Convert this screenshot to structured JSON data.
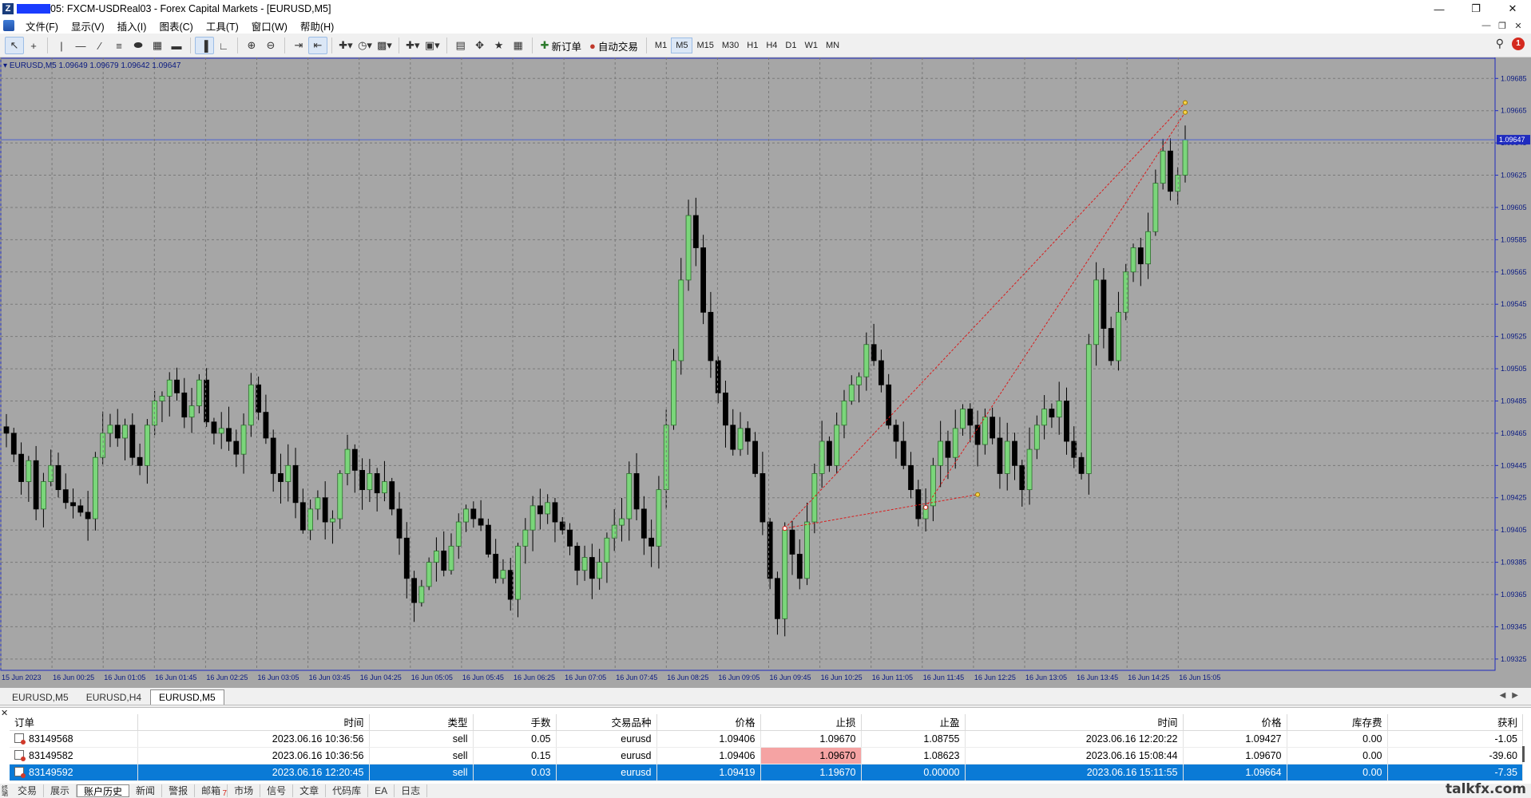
{
  "window": {
    "title": "05: FXCM-USDReal03 - Forex Capital Markets - [EURUSD,M5]",
    "controls": [
      "minimize-icon",
      "restore-icon",
      "close-icon"
    ]
  },
  "menu": {
    "items": [
      "文件(F)",
      "显示(V)",
      "插入(I)",
      "图表(C)",
      "工具(T)",
      "窗口(W)",
      "帮助(H)"
    ]
  },
  "toolbar": {
    "new_order_label": "新订单",
    "auto_trading_label": "自动交易",
    "timeframes": [
      "M1",
      "M5",
      "M15",
      "M30",
      "H1",
      "H4",
      "D1",
      "W1",
      "MN"
    ],
    "active_timeframe": "M5",
    "notification_count": "1"
  },
  "chart": {
    "info_line": "EURUSD,M5  1.09649 1.09679 1.09642 1.09647",
    "current_price": "1.09647",
    "background_color": "#a6a6a6",
    "grid_color": "#7a7a7a",
    "bull_color": "#7ad67a",
    "bear_color": "#000000",
    "price_line_color": "#4d5fcf",
    "trade_line_color": "#d91c1c"
  },
  "chart_data": {
    "type": "candlestick",
    "symbol": "EURUSD",
    "timeframe": "M5",
    "y_ticks": [
      "1.09685",
      "1.09665",
      "1.09645",
      "1.09625",
      "1.09605",
      "1.09585",
      "1.09565",
      "1.09545",
      "1.09525",
      "1.09505",
      "1.09485",
      "1.09465",
      "1.09445",
      "1.09425",
      "1.09405",
      "1.09385",
      "1.09365",
      "1.09345",
      "1.09325"
    ],
    "ylim": [
      1.09318,
      1.09698
    ],
    "x_ticks": [
      "15 Jun 2023",
      "16 Jun 00:25",
      "16 Jun 01:05",
      "16 Jun 01:45",
      "16 Jun 02:25",
      "16 Jun 03:05",
      "16 Jun 03:45",
      "16 Jun 04:25",
      "16 Jun 05:05",
      "16 Jun 05:45",
      "16 Jun 06:25",
      "16 Jun 07:05",
      "16 Jun 07:45",
      "16 Jun 08:25",
      "16 Jun 09:05",
      "16 Jun 09:45",
      "16 Jun 10:25",
      "16 Jun 11:05",
      "16 Jun 11:45",
      "16 Jun 12:25",
      "16 Jun 13:05",
      "16 Jun 13:45",
      "16 Jun 14:25",
      "16 Jun 15:05"
    ],
    "close_path": [
      1.09465,
      1.09452,
      1.09435,
      1.09448,
      1.09418,
      1.09435,
      1.09445,
      1.0943,
      1.09422,
      1.0942,
      1.09416,
      1.09412,
      1.0945,
      1.09465,
      1.0947,
      1.09462,
      1.0947,
      1.0945,
      1.09445,
      1.0947,
      1.09485,
      1.09488,
      1.09498,
      1.0949,
      1.09475,
      1.09482,
      1.09498,
      1.09472,
      1.09465,
      1.09468,
      1.0946,
      1.09452,
      1.0947,
      1.09495,
      1.09478,
      1.09462,
      1.0944,
      1.09435,
      1.09445,
      1.09422,
      1.09405,
      1.09418,
      1.09425,
      1.0941,
      1.09412,
      1.0944,
      1.09455,
      1.09442,
      1.0943,
      1.0944,
      1.09428,
      1.09435,
      1.09418,
      1.094,
      1.09375,
      1.0936,
      1.0937,
      1.09385,
      1.09392,
      1.0938,
      1.09395,
      1.0941,
      1.09418,
      1.09412,
      1.09408,
      1.0939,
      1.09375,
      1.0938,
      1.09362,
      1.09395,
      1.09405,
      1.0942,
      1.09415,
      1.09422,
      1.0941,
      1.09405,
      1.09395,
      1.0938,
      1.09388,
      1.09375,
      1.09385,
      1.094,
      1.09408,
      1.09412,
      1.0944,
      1.09418,
      1.094,
      1.09395,
      1.0943,
      1.0947,
      1.0951,
      1.0956,
      1.096,
      1.0958,
      1.0954,
      1.0951,
      1.0949,
      1.0947,
      1.09455,
      1.09468,
      1.0946,
      1.0944,
      1.0941,
      1.09375,
      1.0935,
      1.09405,
      1.0939,
      1.09375,
      1.0941,
      1.0944,
      1.0946,
      1.09445,
      1.0947,
      1.09485,
      1.09495,
      1.095,
      1.0952,
      1.0951,
      1.09495,
      1.0947,
      1.0946,
      1.09445,
      1.0943,
      1.09412,
      1.0942,
      1.09445,
      1.0946,
      1.0945,
      1.09468,
      1.0948,
      1.0947,
      1.09458,
      1.09475,
      1.09462,
      1.0944,
      1.0946,
      1.09445,
      1.0943,
      1.09455,
      1.0947,
      1.0948,
      1.09475,
      1.09485,
      1.0946,
      1.0945,
      1.0944,
      1.0952,
      1.0956,
      1.0953,
      1.0951,
      1.0954,
      1.09565,
      1.0958,
      1.0957,
      1.0959,
      1.0962,
      1.0964,
      1.09615,
      1.09625,
      1.09647
    ],
    "trades": [
      {
        "order": "83149568",
        "open_price": 1.09406,
        "close_price": 1.09427
      },
      {
        "order": "83149582",
        "open_price": 1.09406,
        "close_price": 1.0967
      },
      {
        "order": "83149592",
        "open_price": 1.09419,
        "close_price": 1.09664
      }
    ]
  },
  "chart_tabs": {
    "items": [
      "EURUSD,M5",
      "EURUSD,H4",
      "EURUSD,M5"
    ],
    "active_index": 2
  },
  "terminal": {
    "columns": [
      "订单",
      "时间",
      "类型",
      "手数",
      "交易品种",
      "价格",
      "止损",
      "止盈",
      "时间",
      "价格",
      "库存费",
      "获利"
    ],
    "rows": [
      {
        "order": "83149568",
        "open_time": "2023.06.16 10:36:56",
        "type": "sell",
        "lots": "0.05",
        "symbol": "eurusd",
        "price": "1.09406",
        "sl": "1.09670",
        "tp": "1.08755",
        "close_time": "2023.06.16 12:20:22",
        "close_price": "1.09427",
        "swap": "0.00",
        "profit": "-1.05"
      },
      {
        "order": "83149582",
        "open_time": "2023.06.16 10:36:56",
        "type": "sell",
        "lots": "0.15",
        "symbol": "eurusd",
        "price": "1.09406",
        "sl": "1.09670",
        "tp": "1.08623",
        "close_time": "2023.06.16 15:08:44",
        "close_price": "1.09670",
        "swap": "0.00",
        "profit": "-39.60"
      },
      {
        "order": "83149592",
        "open_time": "2023.06.16 12:20:45",
        "type": "sell",
        "lots": "0.03",
        "symbol": "eurusd",
        "price": "1.09419",
        "sl": "1.19670",
        "tp": "0.00000",
        "close_time": "2023.06.16 15:11:55",
        "close_price": "1.09664",
        "swap": "0.00",
        "profit": "-7.35"
      }
    ],
    "selected_row": 2
  },
  "bottom_tabs": {
    "side_label": "终端",
    "items": [
      "交易",
      "展示",
      "账户历史",
      "新闻",
      "警报",
      "邮箱",
      "市场",
      "信号",
      "文章",
      "代码库",
      "EA",
      "日志"
    ],
    "active_index": 2,
    "mailbox_count": "7"
  },
  "watermark": "talkfx.com"
}
